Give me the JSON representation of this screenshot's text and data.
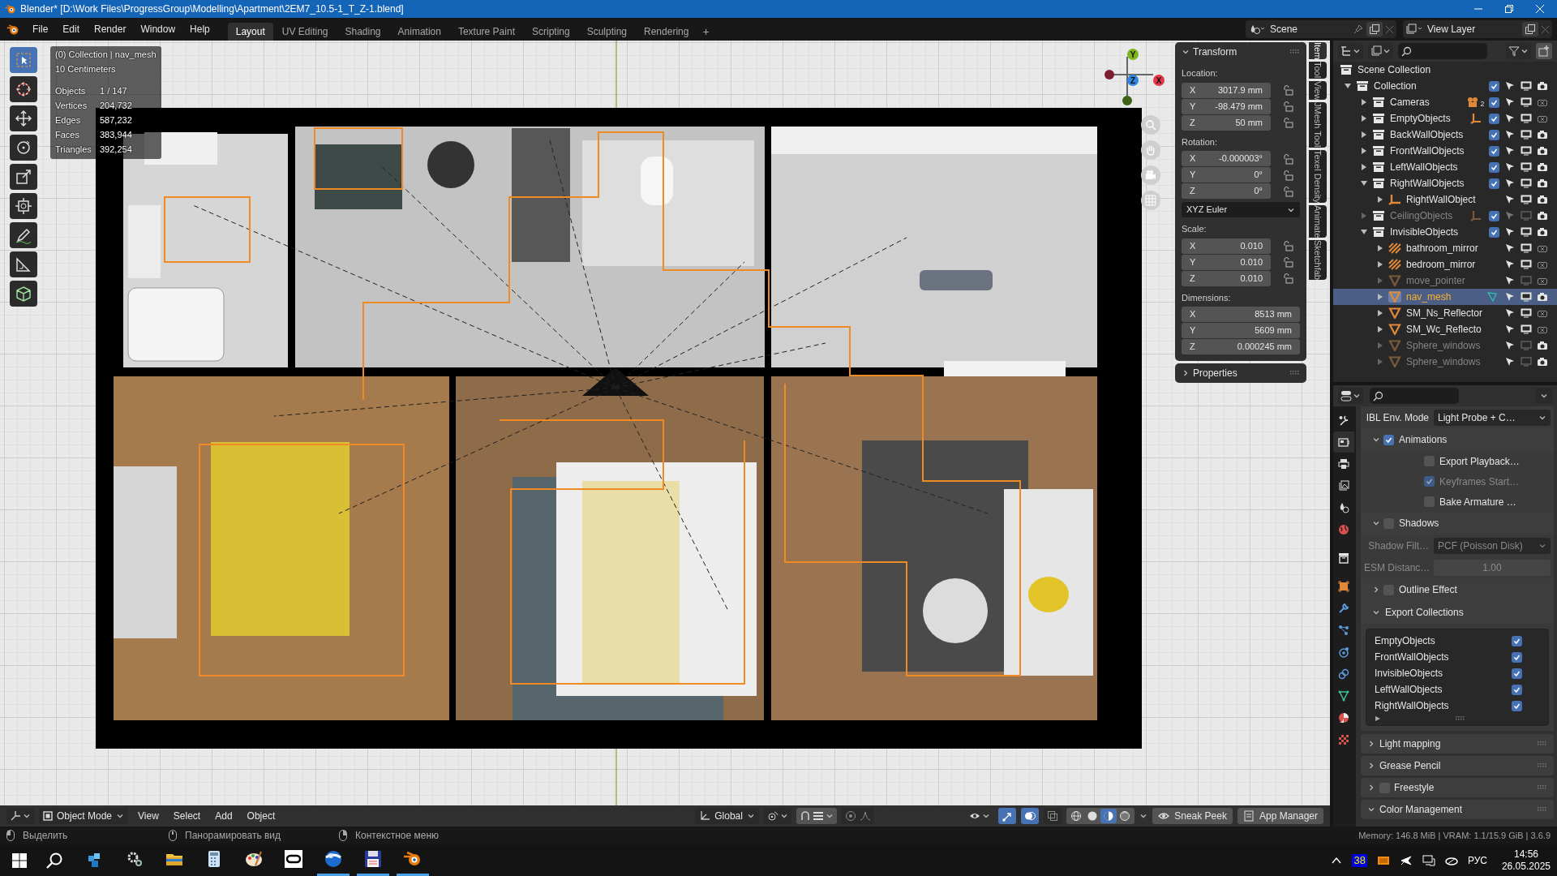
{
  "window": {
    "title": "Blender* [D:\\Work Files\\ProgressGroup\\Modelling\\Apartment\\2EM7_10.5-1_T_Z-1.blend]"
  },
  "menu": [
    "File",
    "Edit",
    "Render",
    "Window",
    "Help"
  ],
  "workspaces": [
    {
      "label": "Layout",
      "selected": true
    },
    {
      "label": "UV Editing",
      "selected": false
    },
    {
      "label": "Shading",
      "selected": false
    },
    {
      "label": "Animation",
      "selected": false
    },
    {
      "label": "Texture Paint",
      "selected": false
    },
    {
      "label": "Scripting",
      "selected": false
    },
    {
      "label": "Sculpting",
      "selected": false
    },
    {
      "label": "Rendering",
      "selected": false
    }
  ],
  "add_workspace": "+",
  "scene": {
    "name": "Scene",
    "view_layer": "View Layer"
  },
  "toolbar": [
    {
      "kind": "select_box",
      "selected": true
    },
    {
      "kind": "cursor",
      "selected": false
    },
    {
      "kind": "move",
      "selected": false
    },
    {
      "kind": "rotate",
      "selected": false
    },
    {
      "kind": "scale",
      "selected": false
    },
    {
      "kind": "transform",
      "selected": false
    },
    {
      "kind": "annotate",
      "selected": false
    },
    {
      "kind": "measure",
      "selected": false
    },
    {
      "kind": "add_cube",
      "selected": false
    }
  ],
  "overlay": {
    "context": "(0) Collection | nav_mesh",
    "grid": "10 Centimeters",
    "stats": [
      {
        "label": "Objects",
        "value": "1 / 147"
      },
      {
        "label": "Vertices",
        "value": "204,732"
      },
      {
        "label": "Edges",
        "value": "587,232"
      },
      {
        "label": "Faces",
        "value": "383,944"
      },
      {
        "label": "Triangles",
        "value": "392,254"
      }
    ]
  },
  "gizmo": {
    "axes": [
      {
        "label": "Y",
        "color": "#7cb51e"
      },
      {
        "label": "Z",
        "color": "#2f86e0"
      },
      {
        "label": "X",
        "color": "#e2394a"
      }
    ]
  },
  "sidebar": {
    "title": "Transform",
    "groups": [
      {
        "label": "Location:",
        "fields": [
          {
            "axis": "X",
            "value": "3017.9 mm",
            "locked": false
          },
          {
            "axis": "Y",
            "value": "-98.479 mm",
            "locked": false
          },
          {
            "axis": "Z",
            "value": "50 mm",
            "locked": false
          }
        ]
      },
      {
        "label": "Rotation:",
        "fields": [
          {
            "axis": "X",
            "value": "-0.000003°",
            "locked": false
          },
          {
            "axis": "Y",
            "value": "0°",
            "locked": false
          },
          {
            "axis": "Z",
            "value": "0°",
            "locked": false
          }
        ],
        "mode": "XYZ Euler"
      },
      {
        "label": "Scale:",
        "fields": [
          {
            "axis": "X",
            "value": "0.010",
            "locked": false
          },
          {
            "axis": "Y",
            "value": "0.010",
            "locked": false
          },
          {
            "axis": "Z",
            "value": "0.010",
            "locked": false
          }
        ]
      },
      {
        "label": "Dimensions:",
        "fields": [
          {
            "axis": "X",
            "value": "8513 mm"
          },
          {
            "axis": "Y",
            "value": "5609 mm"
          },
          {
            "axis": "Z",
            "value": "0.000245 mm"
          }
        ]
      }
    ],
    "properties": "Properties"
  },
  "sidebar_tabs": [
    {
      "label": "Item",
      "selected": true
    },
    {
      "label": "Tool",
      "selected": false
    },
    {
      "label": "View",
      "selected": false
    },
    {
      "label": "JMesh Tool",
      "selected": false
    },
    {
      "label": "Texel Density",
      "selected": false
    },
    {
      "label": "Animate",
      "selected": false
    },
    {
      "label": "Sketchfab",
      "selected": false
    }
  ],
  "outliner": {
    "items": [
      {
        "name": "Scene Collection",
        "kind": "scene_collection",
        "selected": false,
        "children": [
          {
            "name": "Collection",
            "kind": "collection",
            "expanded": true,
            "selected": false,
            "checked": true,
            "hidden": false,
            "renderable": true,
            "children": [
              {
                "name": "Cameras",
                "kind": "collection",
                "expanded": false,
                "selected": false,
                "checked": true,
                "hidden": false,
                "renderable": false,
                "badge": {
                  "kind": "camera",
                  "count": "2"
                }
              },
              {
                "name": "EmptyObjects",
                "kind": "collection",
                "expanded": false,
                "selected": false,
                "checked": true,
                "hidden": false,
                "renderable": false,
                "badge": {
                  "kind": "empty"
                }
              },
              {
                "name": "BackWallObjects",
                "kind": "collection",
                "expanded": false,
                "selected": false,
                "checked": true,
                "hidden": false,
                "renderable": true
              },
              {
                "name": "FrontWallObjects",
                "kind": "collection",
                "expanded": false,
                "selected": false,
                "checked": true,
                "hidden": false,
                "renderable": true
              },
              {
                "name": "LeftWallObjects",
                "kind": "collection",
                "expanded": false,
                "selected": false,
                "checked": true,
                "hidden": false,
                "renderable": true
              },
              {
                "name": "RightWallObjects",
                "kind": "collection",
                "expanded": true,
                "selected": false,
                "checked": true,
                "hidden": false,
                "renderable": true,
                "children": [
                  {
                    "name": "RightWallObject",
                    "kind": "empty",
                    "expanded": false,
                    "selected": false,
                    "hidden": false,
                    "renderable": true
                  }
                ]
              },
              {
                "name": "CeilingObjects",
                "kind": "collection",
                "expanded": false,
                "selected": false,
                "checked": true,
                "hidden": true,
                "renderable": true,
                "badge": {
                  "kind": "empty"
                }
              },
              {
                "name": "InvisibleObjects",
                "kind": "collection",
                "expanded": true,
                "selected": false,
                "checked": true,
                "hidden": false,
                "renderable": true,
                "children": [
                  {
                    "name": "bathroom_mirror",
                    "kind": "image",
                    "expanded": false,
                    "selected": false,
                    "hidden": false,
                    "renderable": false
                  },
                  {
                    "name": "bedroom_mirror",
                    "kind": "image",
                    "expanded": false,
                    "selected": false,
                    "hidden": false,
                    "renderable": false
                  },
                  {
                    "name": "move_pointer",
                    "kind": "mesh",
                    "expanded": false,
                    "selected": false,
                    "hidden": true,
                    "renderable": false
                  },
                  {
                    "name": "nav_mesh",
                    "kind": "mesh",
                    "expanded": false,
                    "selected": true,
                    "hidden": false,
                    "renderable": true,
                    "badge": {
                      "kind": "mesh_data"
                    }
                  },
                  {
                    "name": "SM_Ns_Reflector",
                    "kind": "mesh",
                    "expanded": false,
                    "selected": false,
                    "hidden": false,
                    "renderable": false
                  },
                  {
                    "name": "SM_Wc_Reflecto",
                    "kind": "mesh",
                    "expanded": false,
                    "selected": false,
                    "hidden": false,
                    "renderable": false
                  },
                  {
                    "name": "Sphere_windows",
                    "kind": "mesh",
                    "expanded": false,
                    "selected": false,
                    "hidden": true,
                    "renderable": true
                  },
                  {
                    "name": "Sphere_windows",
                    "kind": "mesh",
                    "expanded": false,
                    "selected": false,
                    "hidden": true,
                    "renderable": true
                  }
                ]
              }
            ]
          }
        ]
      }
    ]
  },
  "properties": {
    "tabs": [
      {
        "kind": "tool",
        "selected": false
      },
      {
        "kind": "render",
        "selected": true
      },
      {
        "kind": "output",
        "selected": false
      },
      {
        "kind": "view_layer",
        "selected": false
      },
      {
        "kind": "scene",
        "selected": false
      },
      {
        "kind": "world",
        "selected": false
      },
      {
        "kind": "collection",
        "selected": false
      },
      {
        "kind": "object",
        "selected": false
      },
      {
        "kind": "modifiers",
        "selected": false
      },
      {
        "kind": "particles",
        "selected": false
      },
      {
        "kind": "physics",
        "selected": false
      },
      {
        "kind": "constraints",
        "selected": false
      },
      {
        "kind": "data",
        "selected": false
      },
      {
        "kind": "material",
        "selected": false
      },
      {
        "kind": "texture",
        "selected": false
      }
    ],
    "rows": [
      {
        "kind": "dropdown",
        "label": "IBL Env. Mode",
        "value": "Light Probe + C…",
        "disabled": false
      },
      {
        "kind": "subpanel",
        "label": "Animations",
        "expanded": true,
        "checked": true
      },
      {
        "kind": "checkbox",
        "label": "Export Playback…",
        "checked": false,
        "disabled": false
      },
      {
        "kind": "checkbox",
        "label": "Keyframes Start…",
        "checked": true,
        "disabled": true
      },
      {
        "kind": "checkbox",
        "label": "Bake Armature …",
        "checked": false,
        "disabled": false
      },
      {
        "kind": "subpanel",
        "label": "Shadows",
        "expanded": true,
        "checked": false
      },
      {
        "kind": "dropdown",
        "label": "Shadow Filt…",
        "value": "PCF (Poisson Disk)",
        "disabled": true
      },
      {
        "kind": "number",
        "label": "ESM Distanc…",
        "value": "1.00",
        "disabled": true
      },
      {
        "kind": "subpanel",
        "label": "Outline Effect",
        "expanded": false,
        "checked": false
      },
      {
        "kind": "subpanel",
        "label": "Export Collections",
        "expanded": true
      },
      {
        "kind": "list",
        "items": [
          {
            "label": "EmptyObjects",
            "checked": true
          },
          {
            "label": "FrontWallObjects",
            "checked": true
          },
          {
            "label": "InvisibleObjects",
            "checked": true
          },
          {
            "label": "LeftWallObjects",
            "checked": true
          },
          {
            "label": "RightWallObjects",
            "checked": true
          }
        ]
      }
    ],
    "panels": [
      {
        "label": "Light mapping",
        "expanded": false
      },
      {
        "label": "Grease Pencil",
        "expanded": false
      },
      {
        "label": "Freestyle",
        "expanded": false,
        "checked": false
      },
      {
        "label": "Color Management",
        "expanded": true
      }
    ]
  },
  "viewport_header": {
    "mode": "Object Mode",
    "menus": [
      "View",
      "Select",
      "Add",
      "Object"
    ],
    "orientation": "Global",
    "toggles": [
      {
        "kind": "gizmo",
        "on": true
      },
      {
        "kind": "overlay",
        "on": true
      },
      {
        "kind": "xray",
        "on": false
      }
    ],
    "shading": [
      {
        "kind": "wireframe",
        "selected": false
      },
      {
        "kind": "solid",
        "selected": false
      },
      {
        "kind": "material",
        "selected": true
      },
      {
        "kind": "rendered",
        "selected": false
      }
    ],
    "buttons": [
      {
        "kind": "eye",
        "label": "Sneak Peek"
      },
      {
        "kind": "list",
        "label": "App Manager"
      }
    ]
  },
  "status_bar": {
    "hints": [
      "Выделить",
      "Панорамировать вид",
      "Контекстное меню"
    ],
    "info": "Memory: 146.8 MiB | VRAM: 1.1/15.9 GiB | 3.6.9"
  },
  "taskbar": {
    "apps": [
      {
        "kind": "cube",
        "running": false
      },
      {
        "kind": "gears",
        "running": false
      },
      {
        "kind": "folder",
        "running": false
      },
      {
        "kind": "calculator",
        "running": false
      },
      {
        "kind": "palette",
        "running": false
      },
      {
        "kind": "oculus",
        "running": false
      },
      {
        "kind": "globe",
        "running": true
      },
      {
        "kind": "floppy",
        "running": true
      },
      {
        "kind": "blender",
        "running": true
      }
    ],
    "tray": {
      "counter": "38",
      "language": "РУС",
      "time": "14:56",
      "date": "26.05.2025"
    }
  }
}
